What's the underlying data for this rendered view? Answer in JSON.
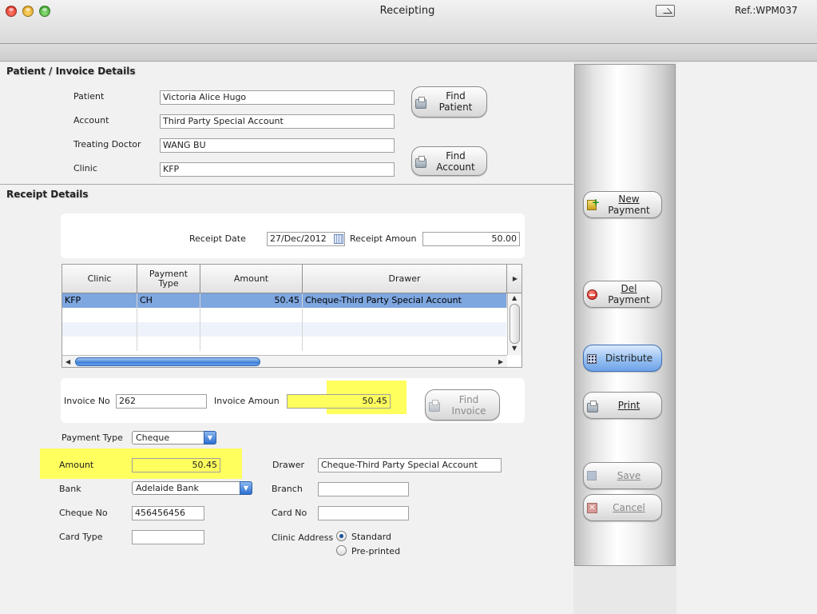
{
  "window": {
    "title": "Receipting",
    "ref": "Ref.:WPM037"
  },
  "patient_section": {
    "title": "Patient / Invoice Details",
    "fields": {
      "patient_label": "Patient",
      "patient_value": "Victoria Alice Hugo",
      "account_label": "Account",
      "account_value": "Third Party Special Account",
      "doctor_label": "Treating Doctor",
      "doctor_value": "WANG BU",
      "clinic_label": "Clinic",
      "clinic_value": "KFP"
    },
    "find_patient": {
      "line1": "Find",
      "line2": "Patient"
    },
    "find_account": {
      "line1": "Find",
      "line2": "Account"
    }
  },
  "receipt_section": {
    "title": "Receipt Details",
    "receipt_date_label": "Receipt Date",
    "receipt_date_value": "27/Dec/2012",
    "receipt_amount_label": "Receipt Amoun",
    "receipt_amount_value": "50.00",
    "table": {
      "columns": [
        {
          "label": "Clinic"
        },
        {
          "label": "Payment Type"
        },
        {
          "label": "Amount"
        },
        {
          "label": "Drawer"
        }
      ],
      "rows": [
        {
          "clinic": "KFP",
          "payment_type": "CH",
          "amount": "50.45",
          "drawer": "Cheque-Third Party Special Account"
        }
      ]
    },
    "invoice_no_label": "Invoice No",
    "invoice_no_value": "262",
    "invoice_amount_label": "Invoice Amoun",
    "invoice_amount_value": "50.45",
    "find_invoice": {
      "line1": "Find",
      "line2": "Invoice"
    }
  },
  "payment": {
    "payment_type_label": "Payment Type",
    "payment_type_value": "Cheque",
    "amount_label": "Amount",
    "amount_value": "50.45",
    "drawer_label": "Drawer",
    "drawer_value": "Cheque-Third Party Special Account",
    "bank_label": "Bank",
    "bank_value": "Adelaide Bank",
    "branch_label": "Branch",
    "branch_value": "",
    "cheque_no_label": "Cheque No",
    "cheque_no_value": "456456456",
    "card_no_label": "Card No",
    "card_no_value": "",
    "card_type_label": "Card Type",
    "card_type_value": "",
    "clinic_address_label": "Clinic Address",
    "address_options": [
      "Standard",
      "Pre-printed"
    ],
    "address_selected": "Standard"
  },
  "actions": {
    "new_payment": {
      "line1": "New",
      "line2": "Payment"
    },
    "del_payment": {
      "line1": "Del",
      "line2": "Payment"
    },
    "distribute": "Distribute",
    "print": "Print",
    "save": "Save",
    "cancel": "Cancel"
  },
  "colors": {
    "highlight": "#ffff5e",
    "selection": "#7ea6df"
  }
}
